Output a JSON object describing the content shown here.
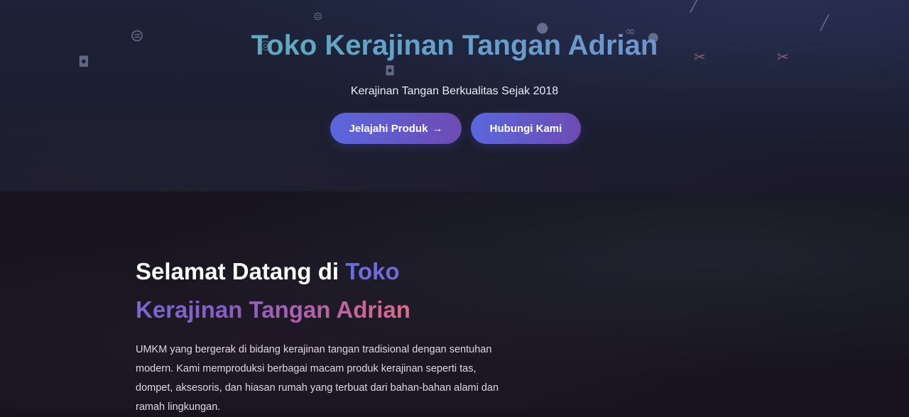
{
  "hero": {
    "title": "Toko Kerajinan Tangan Adrian",
    "subtitle": "Kerajinan Tangan Berkualitas Sejak 2018",
    "buttons": {
      "explore_label": "Jelajahi Produk",
      "explore_arrow": "→",
      "contact_label": "Hubungi Kami"
    },
    "decorations": [
      "thread-spool-icon",
      "bag-icon",
      "needle-icon",
      "yarn-icon",
      "scissors-icon"
    ]
  },
  "about": {
    "title_plain": "Selamat Datang di ",
    "title_highlight": "Toko Kerajinan Tangan Adrian",
    "description": "UMKM yang bergerak di bidang kerajinan tangan tradisional dengan sentuhan modern. Kami memproduksi berbagai macam produk kerajinan seperti tas, dompet, aksesoris, dan hiasan rumah yang terbuat dari bahan-bahan alami dan ramah lingkungan."
  },
  "colors": {
    "accent_start": "#5a67dc",
    "accent_end": "#6e4bb4",
    "highlight_end": "#e06a86"
  }
}
